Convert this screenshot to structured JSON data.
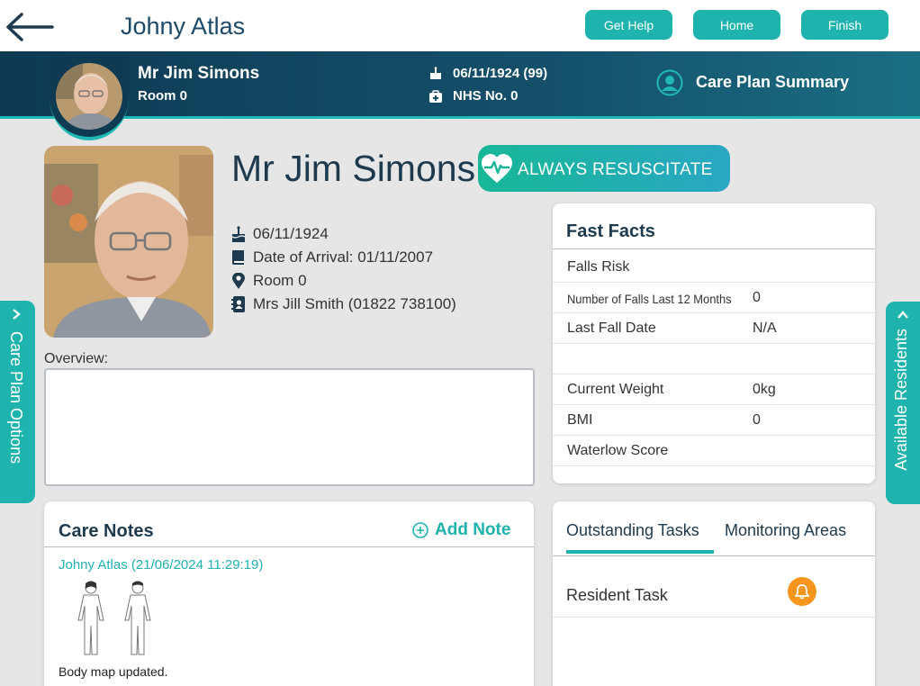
{
  "topbar": {
    "user_name": "Johny Atlas",
    "buttons": {
      "help": "Get Help",
      "home": "Home",
      "finish": "Finish"
    }
  },
  "resident_header": {
    "name": "Mr Jim Simons",
    "room": "Room 0",
    "dob": "06/11/1924 (99)",
    "nhs": "NHS No. 0",
    "summary_label": "Care Plan Summary"
  },
  "profile": {
    "name": "Mr Jim Simons",
    "resus_status": "ALWAYS RESUSCITATE",
    "dob": "06/11/1924",
    "arrival": "Date of Arrival: 01/11/2007",
    "room": "Room 0",
    "contact": "Mrs Jill Smith (01822 738100)"
  },
  "overview": {
    "label": "Overview:",
    "text": ""
  },
  "side_tabs": {
    "left": "Care Plan Options",
    "right": "Available Residents"
  },
  "fast_facts": {
    "title": "Fast Facts",
    "rows": [
      {
        "label": "Falls Risk",
        "value": ""
      },
      {
        "label": "Number of Falls Last 12 Months",
        "value": "0"
      },
      {
        "label": "Last Fall Date",
        "value": "N/A"
      },
      {
        "label": "",
        "value": ""
      },
      {
        "label": "Current Weight",
        "value": "0kg"
      },
      {
        "label": "BMI",
        "value": "0"
      },
      {
        "label": "Waterlow Score",
        "value": ""
      }
    ]
  },
  "care_notes": {
    "title": "Care Notes",
    "add_label": "Add Note",
    "note": {
      "author": "Johny Atlas (21/06/2024 11:29:19)",
      "text": "Body map updated."
    }
  },
  "tasks": {
    "tabs": [
      "Outstanding Tasks",
      "Monitoring Areas"
    ],
    "active_tab": "Outstanding Tasks",
    "rows": [
      {
        "label": "Resident Task"
      }
    ]
  },
  "colors": {
    "accent": "#1eb3ad",
    "header_band": "#0e3a52",
    "alert": "#f7951d"
  }
}
